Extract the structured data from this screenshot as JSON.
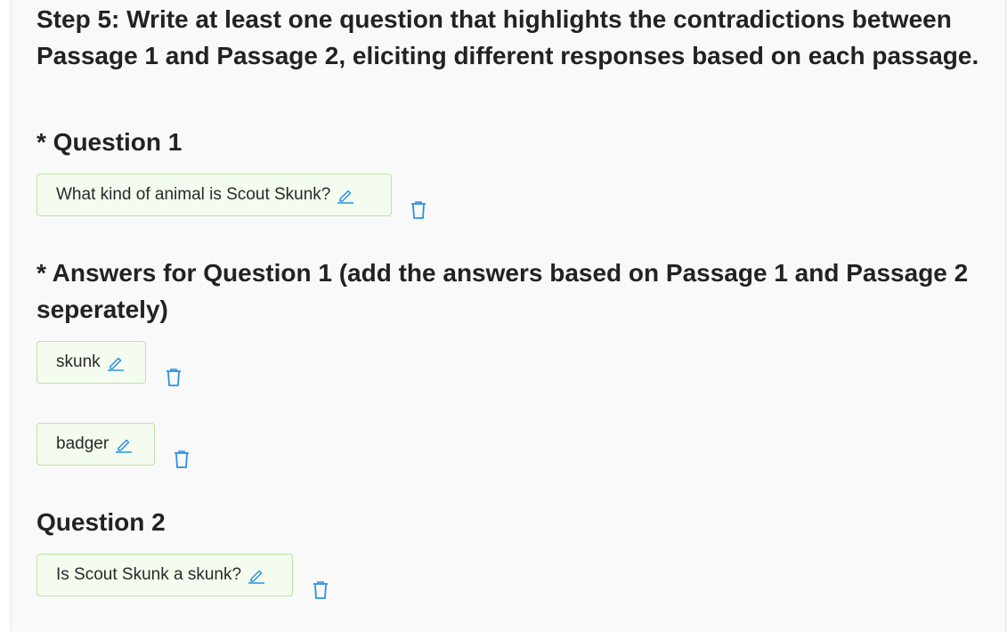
{
  "step": {
    "title": "Step 5: Write at least one question that highlights the contradictions between Passage 1 and Passage 2, eliciting different responses based on each passage."
  },
  "question1": {
    "heading": "* Question 1",
    "text": "What kind of animal is Scout Skunk?"
  },
  "answers1": {
    "heading": "* Answers for Question 1 (add the answers based on Passage 1 and Passage 2 seperately)",
    "items": [
      {
        "text": "skunk"
      },
      {
        "text": "badger"
      }
    ]
  },
  "question2": {
    "heading": "Question 2",
    "text": "Is Scout Skunk a skunk?"
  },
  "icons": {
    "edit": "pencil-icon",
    "delete": "trash-icon",
    "accent": "#2b8fe3"
  }
}
